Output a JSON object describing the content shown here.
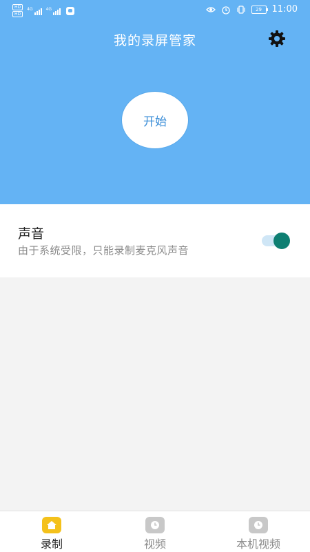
{
  "status_bar": {
    "hd1": "HD",
    "hd2": "HD",
    "net1": "4G",
    "net2": "4G",
    "battery": "29",
    "time": "11:00",
    "icons": [
      "eye-icon",
      "alarm-icon",
      "vibrate-icon"
    ]
  },
  "header": {
    "title": "我的录屏管家",
    "settings_icon": "gear-icon",
    "start_label": "开始"
  },
  "sound": {
    "title": "声音",
    "description": "由于系统受限，只能录制麦克风声音",
    "toggle_on": true
  },
  "bottom_nav": {
    "items": [
      {
        "label": "录制",
        "icon": "home-icon",
        "active": true
      },
      {
        "label": "视频",
        "icon": "clock-icon",
        "active": false
      },
      {
        "label": "本机视频",
        "icon": "clock-icon",
        "active": false
      }
    ]
  },
  "colors": {
    "header_bg": "#64b3f4",
    "toggle_knob": "#0e7f72",
    "nav_active": "#f4c11b",
    "nav_inactive": "#c8c8c8"
  }
}
